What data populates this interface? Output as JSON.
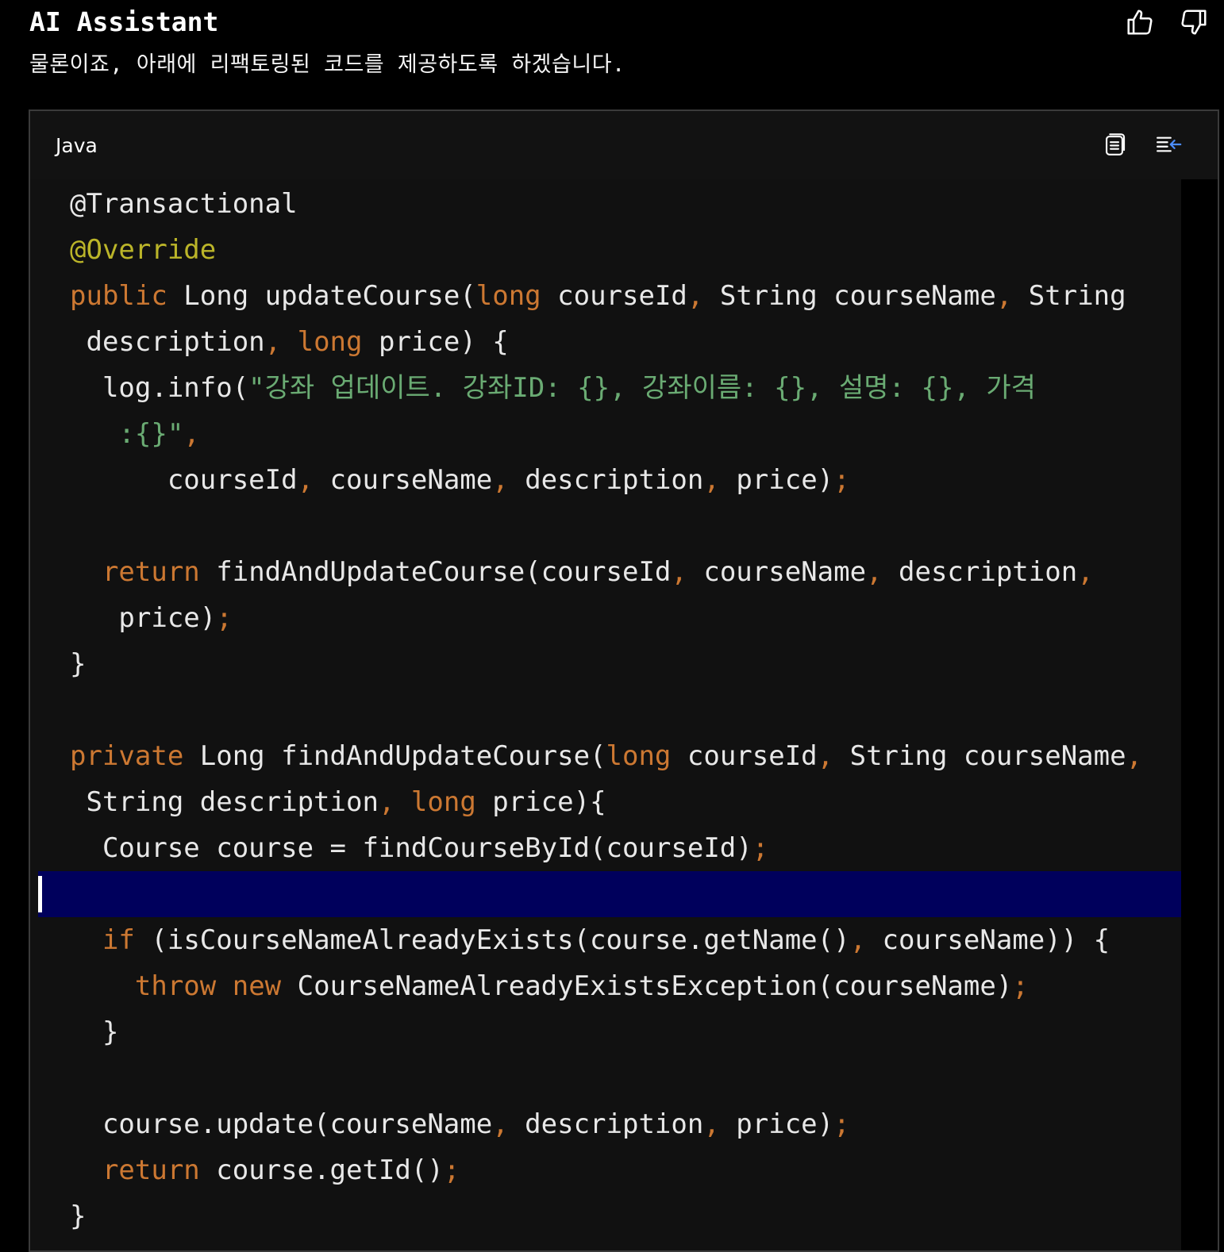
{
  "header": {
    "title": "AI Assistant",
    "message": "물론이죠, 아래에 리팩토링된 코드를 제공하도록 하겠습니다."
  },
  "icons": {
    "thumbs_up": "thumbs-up-icon",
    "thumbs_down": "thumbs-down-icon",
    "copy": "copy-icon",
    "insert": "insert-at-caret-icon"
  },
  "colors": {
    "keyword": "#cc7832",
    "annotation": "#bbb529",
    "string": "#6aab73",
    "default_text": "#e8e8e8",
    "current_line": "#00005c",
    "panel_background": "#121212"
  },
  "code_block": {
    "language": "Java",
    "lines": [
      [
        {
          "t": "@Transactional",
          "c": ""
        }
      ],
      [
        {
          "t": "@Override",
          "c": "ann"
        }
      ],
      [
        {
          "t": "public",
          "c": "kw"
        },
        {
          "t": " Long updateCourse(",
          "c": ""
        },
        {
          "t": "long",
          "c": "kw"
        },
        {
          "t": " courseId",
          "c": ""
        },
        {
          "t": ",",
          "c": "punc"
        },
        {
          "t": " String courseName",
          "c": ""
        },
        {
          "t": ",",
          "c": "punc"
        },
        {
          "t": " String",
          "c": ""
        }
      ],
      [
        {
          "t": " description",
          "c": ""
        },
        {
          "t": ",",
          "c": "punc"
        },
        {
          "t": " ",
          "c": ""
        },
        {
          "t": "long",
          "c": "kw"
        },
        {
          "t": " price) {",
          "c": ""
        }
      ],
      [
        {
          "t": "  log.info(",
          "c": ""
        },
        {
          "t": "\"강좌 업데이트. 강좌ID: {}, 강좌이름: {}, 설명: {}, 가격",
          "c": "str"
        }
      ],
      [
        {
          "t": "   :{}\"",
          "c": "str"
        },
        {
          "t": ",",
          "c": "punc"
        }
      ],
      [
        {
          "t": "      courseId",
          "c": ""
        },
        {
          "t": ",",
          "c": "punc"
        },
        {
          "t": " courseName",
          "c": ""
        },
        {
          "t": ",",
          "c": "punc"
        },
        {
          "t": " description",
          "c": ""
        },
        {
          "t": ",",
          "c": "punc"
        },
        {
          "t": " price)",
          "c": ""
        },
        {
          "t": ";",
          "c": "punc"
        }
      ],
      [],
      [
        {
          "t": "  ",
          "c": ""
        },
        {
          "t": "return",
          "c": "kw"
        },
        {
          "t": " findAndUpdateCourse(courseId",
          "c": ""
        },
        {
          "t": ",",
          "c": "punc"
        },
        {
          "t": " courseName",
          "c": ""
        },
        {
          "t": ",",
          "c": "punc"
        },
        {
          "t": " description",
          "c": ""
        },
        {
          "t": ",",
          "c": "punc"
        }
      ],
      [
        {
          "t": "   price)",
          "c": ""
        },
        {
          "t": ";",
          "c": "punc"
        }
      ],
      [
        {
          "t": "}",
          "c": ""
        }
      ],
      [],
      [
        {
          "t": "private",
          "c": "kw"
        },
        {
          "t": " Long findAndUpdateCourse(",
          "c": ""
        },
        {
          "t": "long",
          "c": "kw"
        },
        {
          "t": " courseId",
          "c": ""
        },
        {
          "t": ",",
          "c": "punc"
        },
        {
          "t": " String courseName",
          "c": ""
        },
        {
          "t": ",",
          "c": "punc"
        }
      ],
      [
        {
          "t": " String description",
          "c": ""
        },
        {
          "t": ",",
          "c": "punc"
        },
        {
          "t": " ",
          "c": ""
        },
        {
          "t": "long",
          "c": "kw"
        },
        {
          "t": " price){",
          "c": ""
        }
      ],
      [
        {
          "t": "  Course course = findCourseById(courseId)",
          "c": ""
        },
        {
          "t": ";",
          "c": "punc"
        }
      ],
      [],
      [
        {
          "t": "  ",
          "c": ""
        },
        {
          "t": "if",
          "c": "kw"
        },
        {
          "t": " (isCourseNameAlreadyExists(course.getName()",
          "c": ""
        },
        {
          "t": ",",
          "c": "punc"
        },
        {
          "t": " courseName)) {",
          "c": ""
        }
      ],
      [
        {
          "t": "    ",
          "c": ""
        },
        {
          "t": "throw",
          "c": "kw"
        },
        {
          "t": " ",
          "c": ""
        },
        {
          "t": "new",
          "c": "kw"
        },
        {
          "t": " CourseNameAlreadyExistsException(courseName)",
          "c": ""
        },
        {
          "t": ";",
          "c": "punc"
        }
      ],
      [
        {
          "t": "  }",
          "c": ""
        }
      ],
      [],
      [
        {
          "t": "  course.update(courseName",
          "c": ""
        },
        {
          "t": ",",
          "c": "punc"
        },
        {
          "t": " description",
          "c": ""
        },
        {
          "t": ",",
          "c": "punc"
        },
        {
          "t": " price)",
          "c": ""
        },
        {
          "t": ";",
          "c": "punc"
        }
      ],
      [
        {
          "t": "  ",
          "c": ""
        },
        {
          "t": "return",
          "c": "kw"
        },
        {
          "t": " course.getId()",
          "c": ""
        },
        {
          "t": ";",
          "c": "punc"
        }
      ],
      [
        {
          "t": "}",
          "c": ""
        }
      ]
    ],
    "current_line_index": 15
  }
}
